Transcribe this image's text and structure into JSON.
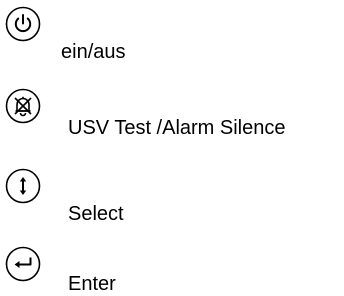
{
  "legend": {
    "items": [
      {
        "icon": "power-icon",
        "label": "ein/aus"
      },
      {
        "icon": "alarm-silence-icon",
        "label": "USV Test /Alarm Silence"
      },
      {
        "icon": "select-arrows-icon",
        "label": "Select"
      },
      {
        "icon": "enter-icon",
        "label": "Enter"
      }
    ]
  }
}
